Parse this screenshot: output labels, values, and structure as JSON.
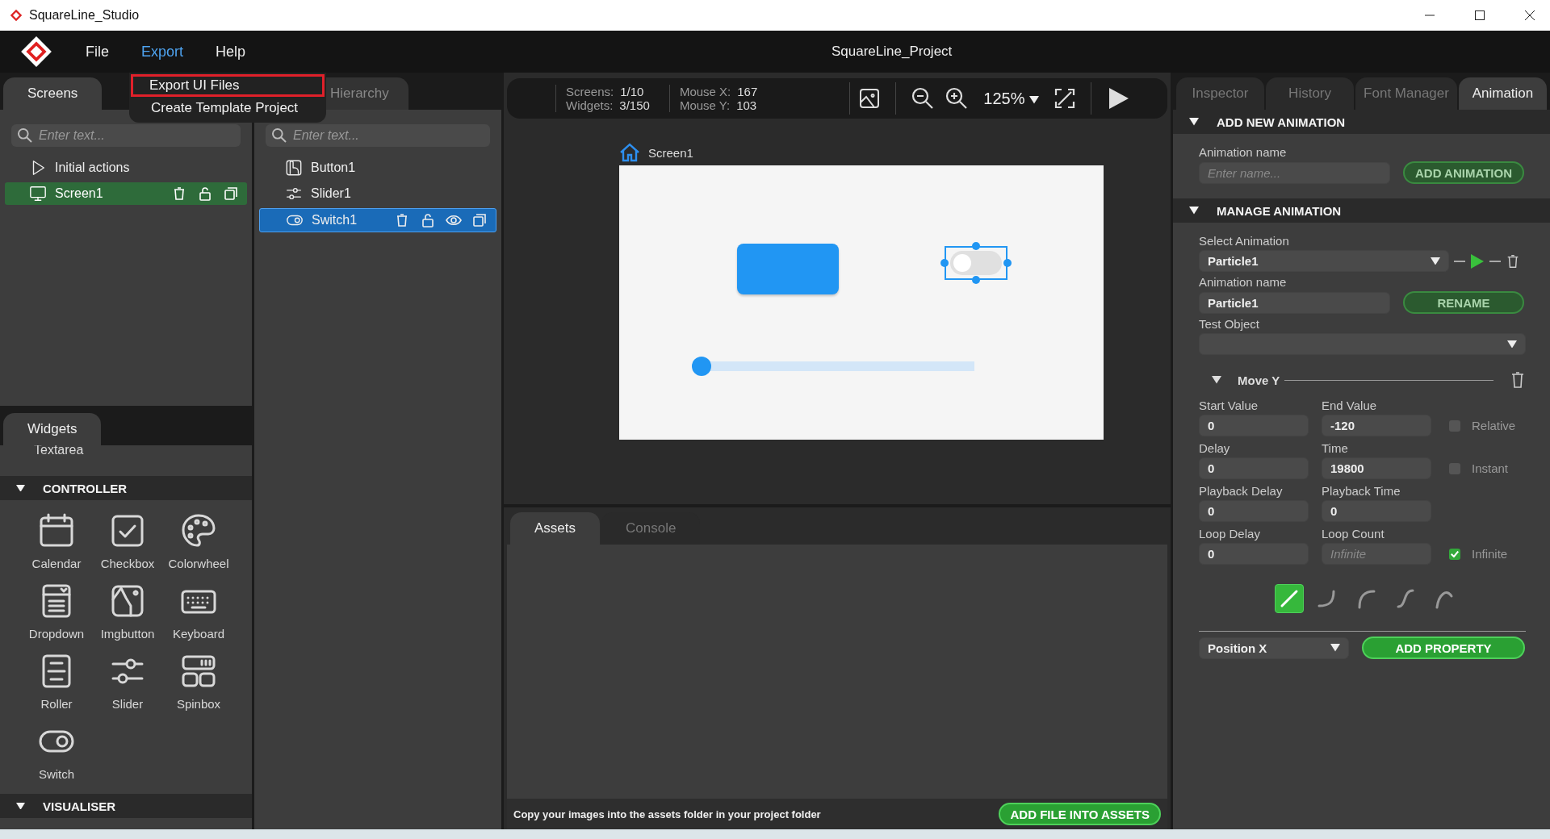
{
  "window": {
    "title": "SquareLine_Studio"
  },
  "menubar": {
    "items": [
      {
        "label": "File",
        "selected": false
      },
      {
        "label": "Export",
        "selected": true
      },
      {
        "label": "Help",
        "selected": false
      }
    ],
    "project_title": "SquareLine_Project"
  },
  "export_menu": {
    "items": [
      {
        "label": "Export UI Files",
        "highlighted": true
      },
      {
        "label": "Create Template Project",
        "highlighted": false
      }
    ]
  },
  "screens_panel": {
    "tab": "Screens",
    "search": {
      "placeholder": "Enter text..."
    },
    "items": [
      {
        "label": "Initial actions",
        "kind": "actions",
        "selected": false
      },
      {
        "label": "Screen1",
        "kind": "screen",
        "selected": true
      }
    ]
  },
  "hierarchy_panel": {
    "tab": "Hierarchy",
    "search": {
      "placeholder": "Enter text..."
    },
    "items": [
      {
        "label": "Button1",
        "kind": "button",
        "selected": false
      },
      {
        "label": "Slider1",
        "kind": "slider",
        "selected": false
      },
      {
        "label": "Switch1",
        "kind": "switch",
        "selected": true
      }
    ]
  },
  "widgets_panel": {
    "tab": "Widgets",
    "cut_item": "Textarea",
    "sections": [
      {
        "title": "CONTROLLER",
        "items": [
          {
            "label": "Calendar",
            "kind": "calendar"
          },
          {
            "label": "Checkbox",
            "kind": "checkbox"
          },
          {
            "label": "Colorwheel",
            "kind": "colorwheel"
          },
          {
            "label": "Dropdown",
            "kind": "dropdown"
          },
          {
            "label": "Imgbutton",
            "kind": "imgbutton"
          },
          {
            "label": "Keyboard",
            "kind": "keyboard"
          },
          {
            "label": "Roller",
            "kind": "roller"
          },
          {
            "label": "Slider",
            "kind": "slider"
          },
          {
            "label": "Spinbox",
            "kind": "spinbox"
          },
          {
            "label": "Switch",
            "kind": "switch"
          }
        ]
      },
      {
        "title": "VISUALISER"
      }
    ]
  },
  "toolbar": {
    "stats": [
      {
        "label": "Screens:",
        "value": "1/10"
      },
      {
        "label": "Widgets:",
        "value": "3/150"
      }
    ],
    "mouse": [
      {
        "label": "Mouse X:",
        "value": "167"
      },
      {
        "label": "Mouse Y:",
        "value": "103"
      }
    ],
    "zoom": "125%"
  },
  "canvas": {
    "screen_label": "Screen1",
    "widgets": [
      {
        "kind": "button"
      },
      {
        "kind": "switch",
        "selected": true
      },
      {
        "kind": "slider",
        "level": 0
      }
    ]
  },
  "bottom_panel": {
    "tabs": [
      {
        "label": "Assets",
        "selected": true
      },
      {
        "label": "Console",
        "selected": false
      }
    ],
    "hint": "Copy your images into the assets folder in your project folder",
    "button": "ADD FILE INTO ASSETS"
  },
  "right_panel": {
    "tabs": [
      {
        "label": "Inspector",
        "selected": false
      },
      {
        "label": "History",
        "selected": false
      },
      {
        "label": "Font Manager",
        "selected": false
      },
      {
        "label": "Animation",
        "selected": true
      }
    ],
    "add_section": {
      "title": "ADD NEW ANIMATION",
      "name_label": "Animation name",
      "name_placeholder": "Enter name...",
      "button": "ADD ANIMATION"
    },
    "manage_section": {
      "title": "MANAGE ANIMATION",
      "select_label": "Select Animation",
      "select_value": "Particle1",
      "name_label": "Animation name",
      "name_value": "Particle1",
      "rename_button": "RENAME",
      "test_label": "Test Object",
      "property": {
        "title": "Move Y",
        "fields": [
          {
            "label": "Start Value",
            "value": "0"
          },
          {
            "label": "End Value",
            "value": "-120",
            "check": {
              "label": "Relative",
              "checked": false
            }
          },
          {
            "label": "Delay",
            "value": "0"
          },
          {
            "label": "Time",
            "value": "19800",
            "check": {
              "label": "Instant",
              "checked": false
            }
          },
          {
            "label": "Playback Delay",
            "value": "0"
          },
          {
            "label": "Playback Time",
            "value": "0"
          },
          {
            "label": "Loop Delay",
            "value": "0"
          },
          {
            "label": "Loop Count",
            "placeholder": "Infinite",
            "check": {
              "label": "Infinite",
              "checked": true
            }
          }
        ],
        "easings": [
          {
            "kind": "linear",
            "selected": true
          },
          {
            "kind": "ease-in",
            "selected": false
          },
          {
            "kind": "ease-out",
            "selected": false
          },
          {
            "kind": "ease-in-out",
            "selected": false
          },
          {
            "kind": "overshoot",
            "selected": false
          }
        ]
      },
      "property_select": "Position X",
      "add_property_button": "ADD PROPERTY"
    }
  }
}
